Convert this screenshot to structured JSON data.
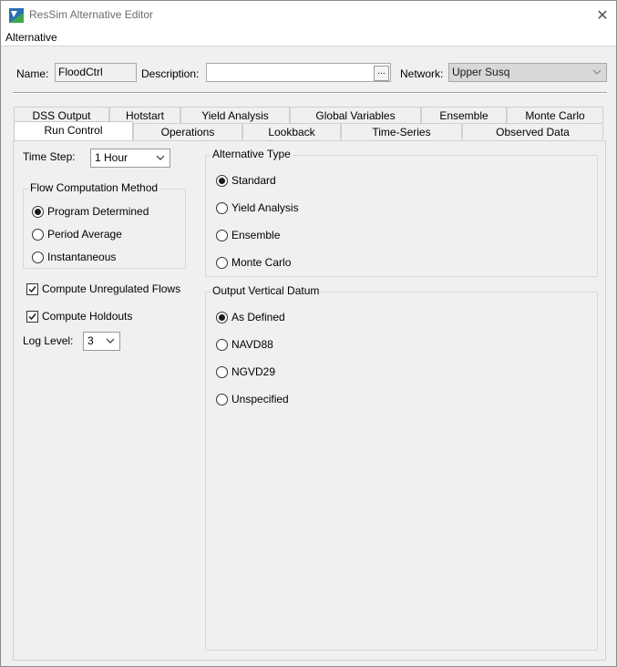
{
  "window": {
    "title": "ResSim Alternative Editor"
  },
  "menu": {
    "items": [
      "Alternative"
    ]
  },
  "header": {
    "name_label": "Name:",
    "name_value": "FloodCtrl",
    "description_label": "Description:",
    "description_value": "",
    "ellipsis_label": "...",
    "network_label": "Network:",
    "network_value": "Upper Susq"
  },
  "tabs": {
    "row1": [
      "DSS Output",
      "Hotstart",
      "Yield Analysis",
      "Global Variables",
      "Ensemble",
      "Monte Carlo"
    ],
    "row2": [
      "Run Control",
      "Operations",
      "Lookback",
      "Time-Series",
      "Observed Data"
    ],
    "active": "Run Control"
  },
  "run_control": {
    "time_step_label": "Time Step:",
    "time_step_value": "1 Hour",
    "flow_method": {
      "title": "Flow Computation Method",
      "options": [
        "Program Determined",
        "Period Average",
        "Instantaneous"
      ],
      "selected": "Program Determined"
    },
    "compute_unregulated_label": "Compute Unregulated Flows",
    "compute_unregulated_checked": true,
    "compute_holdouts_label": "Compute Holdouts",
    "compute_holdouts_checked": true,
    "log_level_label": "Log Level:",
    "log_level_value": "3",
    "alternative_type": {
      "title": "Alternative Type",
      "options": [
        "Standard",
        "Yield Analysis",
        "Ensemble",
        "Monte Carlo"
      ],
      "selected": "Standard"
    },
    "output_vertical_datum": {
      "title": "Output Vertical Datum",
      "options": [
        "As Defined",
        "NAVD88",
        "NGVD29",
        "Unspecified"
      ],
      "selected": "As Defined"
    }
  },
  "colors": {
    "window_bg": "#f0f0f0",
    "active_tab_bg": "#ffffff",
    "disabled_field": "#d8d8d8"
  }
}
